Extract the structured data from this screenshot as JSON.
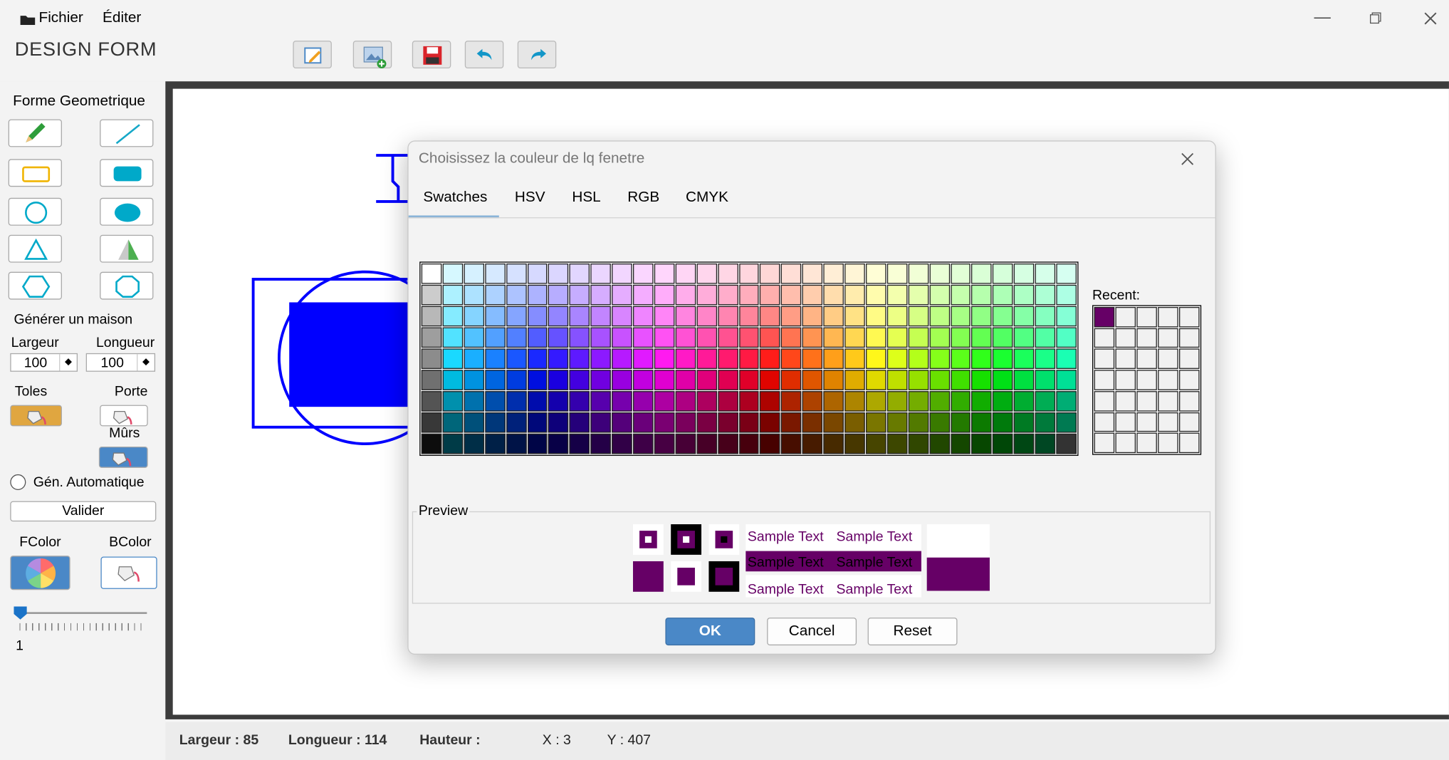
{
  "menu": {
    "file": "Fichier",
    "edit": "Éditer"
  },
  "app": {
    "title": "DESIGN FORM"
  },
  "toolbar": {
    "icons": [
      "edit-icon",
      "add-image-icon",
      "save-icon",
      "undo-icon",
      "redo-icon"
    ]
  },
  "sidebar": {
    "shapes_title": "Forme Geometrique",
    "house_title": "Générer un maison",
    "width_label": "Largeur",
    "width_value": "100",
    "length_label": "Longueur",
    "length_value": "100",
    "roof_label": "Toles",
    "door_label": "Porte",
    "walls_label": "Mûrs",
    "auto_label": "Gén. Automatique",
    "validate_label": "Valider",
    "fcolor_label": "FColor",
    "bcolor_label": "BColor",
    "slider_value": "1"
  },
  "status": {
    "width": "Largeur : 85",
    "length": "Longueur : 114",
    "height": "Hauteur :",
    "x": "X : 3",
    "y": "Y : 407"
  },
  "dialog": {
    "title": "Choisissez la couleur de lq fenetre",
    "tabs": [
      "Swatches",
      "HSV",
      "HSL",
      "RGB",
      "CMYK"
    ],
    "active_tab": "Swatches",
    "recent_label": "Recent:",
    "preview_label": "Preview",
    "sample_text": "Sample Text",
    "selected_color": "#660066",
    "ok": "OK",
    "cancel": "Cancel",
    "reset": "Reset"
  },
  "colors": {
    "accent": "#4a88c7",
    "shape_blue": "#0000ff"
  }
}
